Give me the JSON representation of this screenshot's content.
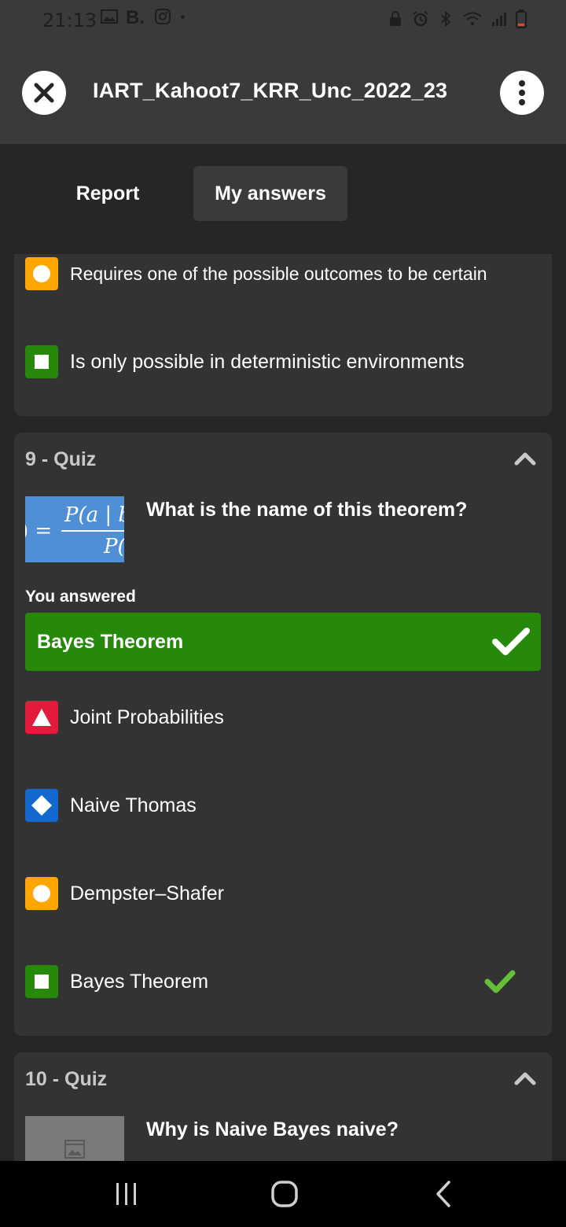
{
  "status_bar": {
    "time": "21:13",
    "left_icons": [
      "gallery-icon",
      "b-app-icon",
      "instagram-icon",
      "dot-icon"
    ],
    "right_icons": [
      "lock-icon",
      "alarm-icon",
      "bluetooth-icon",
      "wifi-icon",
      "signal-icon",
      "battery-low-icon"
    ]
  },
  "header": {
    "title": "IART_Kahoot7_KRR_Unc_2022_23"
  },
  "tabs": [
    {
      "label": "Report"
    },
    {
      "label": "My answers"
    }
  ],
  "partial_question": {
    "options": [
      {
        "shape": "circle",
        "text": "Requires one of the possible outcomes to be certain",
        "color": "#ffa602"
      },
      {
        "shape": "square",
        "text": "Is only possible in deterministic environments",
        "color": "#26890c"
      }
    ]
  },
  "question_9": {
    "header": "9 - Quiz",
    "question": "What is the name of this theorem?",
    "image_formula": {
      "top": "P(a | b",
      "left": ") =",
      "bottom": "P("
    },
    "you_answered_label": "You answered",
    "your_answer": "Bayes Theorem",
    "options": [
      {
        "shape": "triangle",
        "text": "Joint Probabilities",
        "color": "#e21b3c",
        "correct": false
      },
      {
        "shape": "diamond",
        "text": "Naive Thomas",
        "color": "#1368ce",
        "correct": false
      },
      {
        "shape": "circle",
        "text": "Dempster–Shafer",
        "color": "#ffa602",
        "correct": false
      },
      {
        "shape": "square",
        "text": "Bayes Theorem",
        "color": "#26890c",
        "correct": true
      }
    ]
  },
  "question_10": {
    "header": "10 - Quiz",
    "question": "Why is Naive Bayes naive?"
  },
  "colors": {
    "correct_bar": "#26890c",
    "check_green": "#66bf39"
  }
}
